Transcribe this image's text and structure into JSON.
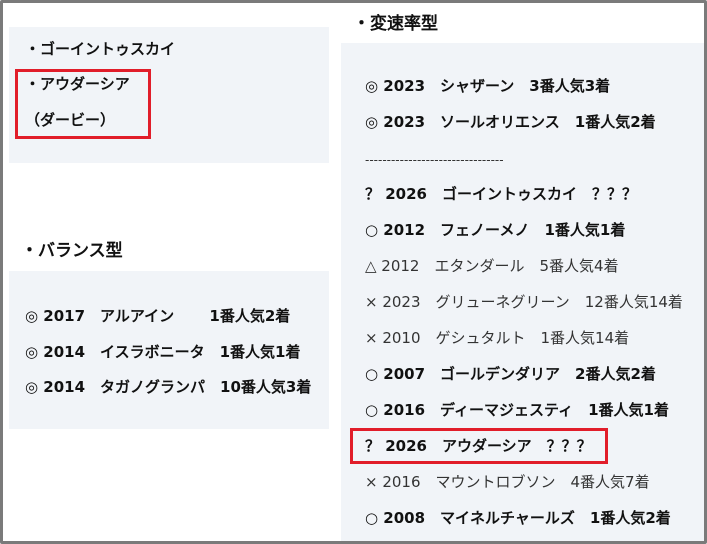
{
  "left": {
    "top_items": [
      "・ゴーイントゥスカイ",
      "・アウダーシア",
      "（ダービー）"
    ],
    "balance": {
      "heading": "・バランス型",
      "rows": [
        "◎ 2017　アルアイン　　 1番人気2着",
        "◎ 2014　イスラボニータ　1番人気1着",
        "◎ 2014　タガノグランパ　10番人気3着"
      ]
    }
  },
  "right": {
    "heading": "・変速率型",
    "rows": [
      "◎ 2023　シャザーン　3番人気3着",
      "◎ 2023　ソールオリエンス　1番人気2着",
      "--------------------------------",
      "？ 2026　ゴーイントゥスカイ　？？？",
      "○ 2012　フェノーメノ　1番人気1着",
      "△ 2012　エタンダール　5番人気4着",
      "× 2023　グリューネグリーン　12番人気14着",
      "× 2010　ゲシュタルト　1番人気14着",
      "○ 2007　ゴールデンダリア　2番人気2着",
      "○ 2016　ディーマジェスティ　1番人気1着",
      "？ 2026　アウダーシア　？？？",
      "× 2016　マウントロブソン　4番人気7着",
      "○ 2008　マイネルチャールズ　1番人気2着"
    ]
  },
  "colors": {
    "panel_bg": "#f1f4f8",
    "highlight_box": "#e11d2a",
    "frame_border": "#7a7a7a"
  }
}
